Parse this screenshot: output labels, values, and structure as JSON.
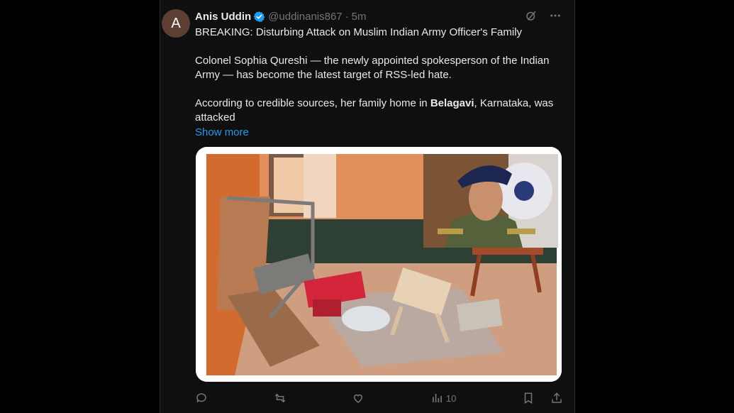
{
  "author": {
    "avatar_letter": "A",
    "avatar_color": "#5c3e33",
    "name": "Anis Uddin",
    "verified_icon": "verified-badge-icon",
    "handle": "@uddinanis867",
    "separator": "·",
    "time": "5m"
  },
  "header_icons": [
    "grok-icon",
    "more-icon"
  ],
  "post": {
    "line1": "BREAKING: Disturbing Attack on Muslim Indian Army Officer's Family",
    "line2": "Colonel Sophia Qureshi — the newly appointed spokesperson of the Indian Army — has become the latest target of RSS-led hate.",
    "line3_before": "According to credible sources, her family home in ",
    "line3_bold": "Belagavi",
    "line3_after": ", Karnataka, was attacked",
    "show_more": "Show more"
  },
  "media": {
    "main_image": "photo of a vandalized room with broken chairs and debris on the floor",
    "inset_image": "portrait of a woman army officer in uniform and beret"
  },
  "actions": {
    "reply_icon": "reply-icon",
    "repost_icon": "repost-icon",
    "like_icon": "like-icon",
    "views_icon": "views-icon",
    "views_count": "10",
    "bookmark_icon": "bookmark-icon",
    "share_icon": "share-icon"
  },
  "colors": {
    "background": "#000000",
    "card": "#0f0f0f",
    "text": "#e7e9ea",
    "muted": "#71767b",
    "link": "#1d9bf0",
    "verified": "#1d9bf0"
  }
}
